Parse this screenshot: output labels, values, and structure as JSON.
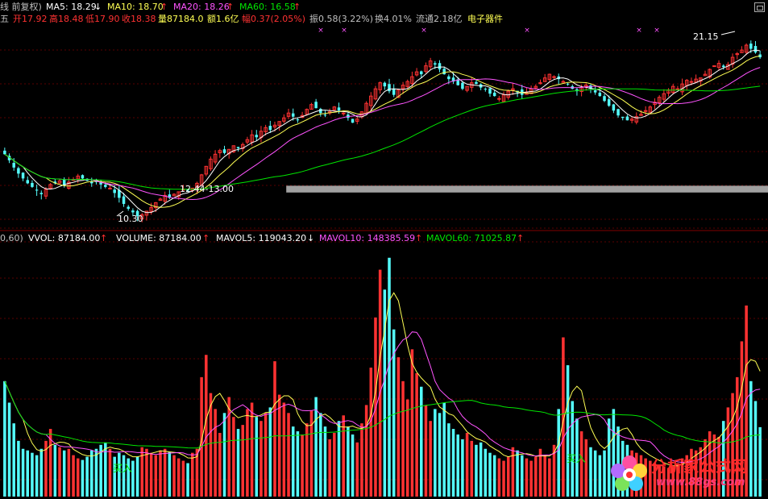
{
  "header": {
    "period_label": "线 前复权)",
    "ma5_label": "MA5: 18.29",
    "ma10_label": "MA10: 18.70",
    "ma20_label": "MA20: 18.26",
    "ma60_label": "MA60: 16.58"
  },
  "quote": {
    "day_label": "五",
    "open_label": "开17.92",
    "high_label": "高18.48",
    "low_label": "低17.90",
    "close_label": "收18.38",
    "volume_label": "量87184.0",
    "amount_label": "额1.6亿",
    "change_label": "幅0.37(2.05%)",
    "amplitude_label": "振0.58(3.22%)",
    "turnover_label": "换4.01%",
    "float_label": "流通2.18亿",
    "sector_label": "电子器件"
  },
  "volume_header": {
    "params_label": "0,60)",
    "vvol_label": "VVOL: 87184.00",
    "volume_label": "VOLUME: 87184.00",
    "mavol5_label": "MAVOL5: 119043.20",
    "mavol10_label": "MAVOL10: 148385.59",
    "mavol60_label": "MAVOL60: 71025.87"
  },
  "annotations": {
    "high_price": "21.15",
    "low_price": "10.30",
    "gap_range": "12.44-13.00",
    "buy_signal_1": "买入",
    "buy_signal_2": "买入"
  },
  "watermark": {
    "title": "分析家公式网",
    "url": "www.88gs.com"
  },
  "colors": {
    "up": "#ff3232",
    "down": "#54fcfc",
    "ma5": "#ffffff",
    "ma10": "#ffff54",
    "ma20": "#ff54ff",
    "ma60": "#00e600",
    "grid": "#5a0000",
    "gap_band": "#a0a0a0"
  },
  "chart_data": [
    {
      "type": "candlestick",
      "title": "",
      "series": [
        {
          "name": "MA5",
          "value": 18.29
        },
        {
          "name": "MA10",
          "value": 18.7
        },
        {
          "name": "MA20",
          "value": 18.26
        },
        {
          "name": "MA60",
          "value": 16.58
        }
      ],
      "close": [
        15.6,
        15.1,
        14.5,
        14.0,
        13.6,
        13.2,
        12.9,
        12.6,
        12.3,
        12.7,
        13.1,
        13.2,
        13.4,
        13.0,
        13.3,
        13.5,
        13.8,
        13.6,
        13.4,
        13.2,
        13.3,
        13.1,
        12.9,
        12.8,
        12.4,
        12.0,
        11.5,
        11.1,
        10.8,
        10.5,
        10.6,
        10.9,
        11.2,
        11.6,
        11.9,
        12.2,
        12.0,
        12.3,
        12.5,
        12.7,
        12.6,
        12.8,
        13.2,
        13.9,
        14.6,
        15.2,
        15.6,
        15.9,
        15.7,
        16.0,
        16.3,
        16.1,
        16.4,
        16.8,
        17.2,
        17.0,
        17.5,
        17.8,
        17.6,
        18.0,
        18.3,
        18.6,
        19.0,
        18.7,
        18.4,
        18.8,
        19.3,
        19.7,
        19.4,
        19.0,
        18.8,
        19.1,
        19.5,
        19.2,
        19.0,
        18.6,
        18.2,
        18.5,
        19.1,
        19.8,
        20.4,
        21.0,
        21.5,
        21.2,
        20.8,
        20.5,
        20.9,
        21.3,
        21.6,
        22.0,
        22.4,
        22.2,
        22.9,
        23.3,
        23.0,
        22.6,
        22.2,
        21.8,
        21.6,
        21.3,
        21.0,
        21.2,
        21.5,
        21.4,
        21.1,
        21.0,
        20.6,
        20.4,
        20.2,
        20.5,
        20.8,
        21.0,
        20.7,
        20.5,
        20.7,
        21.0,
        21.2,
        21.5,
        21.9,
        22.2,
        22.0,
        21.8,
        21.6,
        21.4,
        21.0,
        20.8,
        21.1,
        21.3,
        21.0,
        20.7,
        20.4,
        20.0,
        19.6,
        19.2,
        18.8,
        18.6,
        18.4,
        18.5,
        18.7,
        18.9,
        19.2,
        19.5,
        19.9,
        20.3,
        20.6,
        20.9,
        21.2,
        21.0,
        21.4,
        21.7,
        21.6,
        21.8,
        21.9,
        22.2,
        22.6,
        22.9,
        23.1,
        22.8,
        23.0,
        23.6,
        23.9,
        24.2,
        24.6,
        24.3,
        24.0,
        23.6
      ],
      "ylim": [
        9.5,
        26.2
      ],
      "annotations": {
        "high": 21.15,
        "low": 10.3,
        "gap": "12.44-13.00"
      }
    },
    {
      "type": "bar",
      "title": "",
      "series": [
        {
          "name": "VVOL",
          "value": 87184.0
        },
        {
          "name": "VOLUME",
          "value": 87184.0
        },
        {
          "name": "MAVOL5",
          "value": 119043.2
        },
        {
          "name": "MAVOL10",
          "value": 148385.59
        },
        {
          "name": "MAVOL60",
          "value": 71025.87
        }
      ],
      "values": [
        145000,
        118000,
        92000,
        70000,
        60000,
        58000,
        55000,
        52000,
        60000,
        70000,
        85000,
        65000,
        62000,
        58000,
        60000,
        52000,
        48000,
        46000,
        50000,
        58000,
        60000,
        65000,
        68000,
        60000,
        50000,
        55000,
        52000,
        48000,
        45000,
        50000,
        62000,
        60000,
        55000,
        52000,
        58000,
        60000,
        56000,
        52000,
        48000,
        45000,
        42000,
        55000,
        60000,
        150000,
        178000,
        130000,
        110000,
        80000,
        105000,
        125000,
        100000,
        85000,
        90000,
        110000,
        118000,
        100000,
        95000,
        105000,
        112000,
        170000,
        128000,
        118000,
        105000,
        88000,
        82000,
        78000,
        92000,
        108000,
        125000,
        105000,
        88000,
        72000,
        80000,
        95000,
        102000,
        88000,
        78000,
        68000,
        92000,
        115000,
        162000,
        225000,
        285000,
        260000,
        300000,
        210000,
        175000,
        145000,
        122000,
        185000,
        155000,
        138000,
        115000,
        95000,
        110000,
        105000,
        118000,
        92000,
        85000,
        78000,
        72000,
        80000,
        70000,
        65000,
        68000,
        60000,
        55000,
        52000,
        48000,
        45000,
        50000,
        62000,
        58000,
        52000,
        48000,
        45000,
        50000,
        60000,
        52000,
        48000,
        65000,
        110000,
        200000,
        165000,
        120000,
        98000,
        82000,
        72000,
        62000,
        58000,
        52000,
        58000,
        98000,
        110000,
        88000,
        70000,
        65000,
        58000,
        55000,
        52000,
        48000,
        45000,
        42000,
        40000,
        38000,
        36000,
        38000,
        42000,
        48000,
        52000,
        60000,
        58000,
        62000,
        72000,
        82000,
        78000,
        75000,
        95000,
        112000,
        130000,
        150000,
        195000,
        240000,
        145000,
        120000,
        87184
      ],
      "ylim": [
        0,
        320000
      ],
      "signals": [
        "买入",
        "买入"
      ]
    }
  ]
}
